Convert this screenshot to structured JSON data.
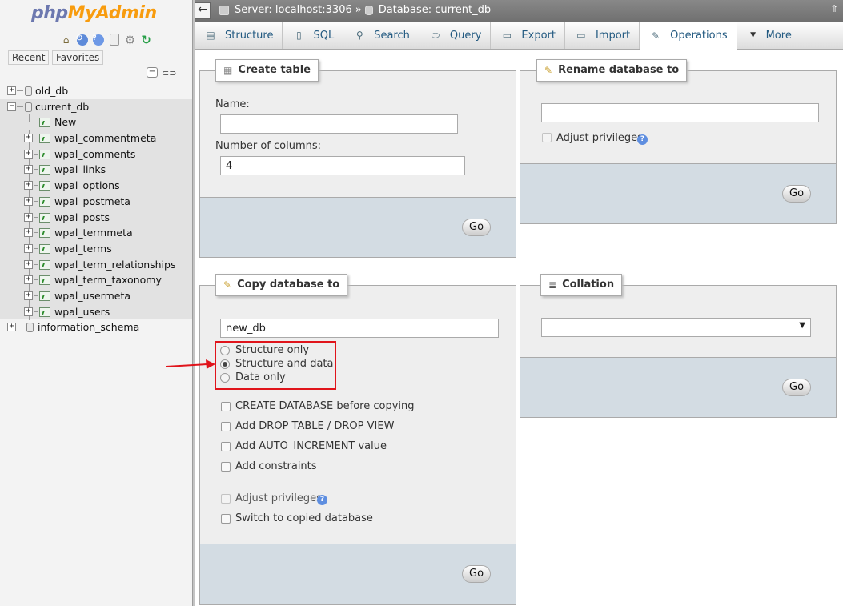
{
  "app": {
    "logo_php": "php",
    "logo_myadmin": "MyAdmin"
  },
  "sidebar": {
    "recent_label": "Recent",
    "favorites_label": "Favorites",
    "collapse_label": "−",
    "databases": [
      {
        "name": "old_db",
        "expanded": false
      },
      {
        "name": "current_db",
        "expanded": true
      },
      {
        "name": "information_schema",
        "expanded": false
      }
    ],
    "new_label": "New",
    "tables": [
      "wpal_commentmeta",
      "wpal_comments",
      "wpal_links",
      "wpal_options",
      "wpal_postmeta",
      "wpal_posts",
      "wpal_termmeta",
      "wpal_terms",
      "wpal_term_relationships",
      "wpal_term_taxonomy",
      "wpal_usermeta",
      "wpal_users"
    ]
  },
  "topbar": {
    "back_label": "←",
    "server_crumb": "Server: localhost:3306",
    "separator": "»",
    "database_crumb": "Database: current_db",
    "window_control": "⇑"
  },
  "tabs": [
    {
      "label": "Structure",
      "icon": "structure-icon",
      "active": false
    },
    {
      "label": "SQL",
      "icon": "sql-icon",
      "active": false
    },
    {
      "label": "Search",
      "icon": "search-icon",
      "active": false
    },
    {
      "label": "Query",
      "icon": "query-icon",
      "active": false
    },
    {
      "label": "Export",
      "icon": "export-icon",
      "active": false
    },
    {
      "label": "Import",
      "icon": "import-icon",
      "active": false
    },
    {
      "label": "Operations",
      "icon": "wrench-icon",
      "active": true
    },
    {
      "label": "More",
      "icon": "caret-down-icon",
      "active": false
    }
  ],
  "create_table": {
    "title": "Create table",
    "name_label": "Name:",
    "name_value": "",
    "columns_label": "Number of columns:",
    "columns_value": "4",
    "go_label": "Go"
  },
  "rename_db": {
    "title": "Rename database to",
    "value": "",
    "adjust_privileges_label": "Adjust privileges",
    "go_label": "Go"
  },
  "copy_db": {
    "title": "Copy database to",
    "value": "new_db",
    "radio_options": [
      {
        "label": "Structure only",
        "checked": false
      },
      {
        "label": "Structure and data",
        "checked": true
      },
      {
        "label": "Data only",
        "checked": false
      }
    ],
    "checkboxes": [
      {
        "label": "CREATE DATABASE before copying",
        "checked": false,
        "disabled": false
      },
      {
        "label": "Add DROP TABLE / DROP VIEW",
        "checked": false,
        "disabled": false
      },
      {
        "label": "Add AUTO_INCREMENT value",
        "checked": false,
        "disabled": false
      },
      {
        "label": "Add constraints",
        "checked": false,
        "disabled": false
      }
    ],
    "adjust_privileges_label": "Adjust privileges",
    "switch_label": "Switch to copied database",
    "go_label": "Go"
  },
  "collation": {
    "title": "Collation",
    "selected": "",
    "go_label": "Go"
  },
  "colors": {
    "highlight_box": "#e0141b",
    "link_blue": "#235a81",
    "panel_bg": "#eeeeee",
    "panel_footer": "#d3dce3"
  }
}
